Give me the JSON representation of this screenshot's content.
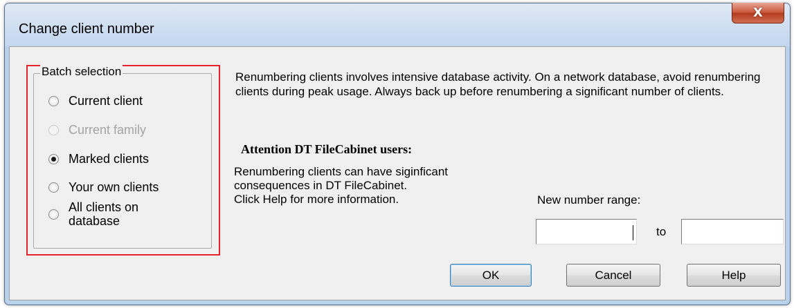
{
  "window": {
    "title": "Change client number",
    "close_icon": "x-icon",
    "close_glyph": "X"
  },
  "batch_selection": {
    "legend": "Batch selection",
    "options": [
      {
        "label": "Current client",
        "selected": false,
        "enabled": true
      },
      {
        "label": "Current family",
        "selected": false,
        "enabled": false
      },
      {
        "label": "Marked clients",
        "selected": true,
        "enabled": true
      },
      {
        "label": "Your own clients",
        "selected": false,
        "enabled": true
      },
      {
        "label": "All clients on database",
        "selected": false,
        "enabled": true
      }
    ],
    "highlight_color": "#e8202a"
  },
  "notice": {
    "text": "Renumbering clients involves intensive database activity. On a network database, avoid renumbering clients during peak usage. Always back up before renumbering a significant number of clients."
  },
  "attention": {
    "heading": "Attention DT FileCabinet users:",
    "lines": [
      "Renumbering clients can have siginficant",
      "consequences in DT FileCabinet.",
      "Click Help for more information."
    ]
  },
  "range": {
    "label": "New number range:",
    "from_value": "",
    "to_label": "to",
    "to_value": ""
  },
  "buttons": {
    "ok": "OK",
    "cancel": "Cancel",
    "help": "Help"
  }
}
